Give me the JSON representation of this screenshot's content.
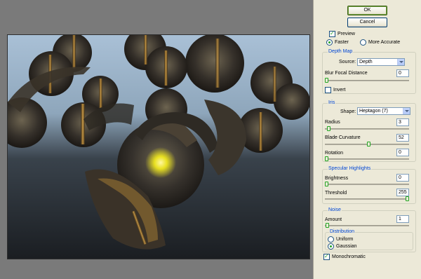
{
  "buttons": {
    "ok": "OK",
    "cancel": "Cancel"
  },
  "preview": {
    "label": "Preview",
    "checked": true
  },
  "quality": {
    "faster": "Faster",
    "more_accurate": "More Accurate",
    "selected": "faster"
  },
  "depth_map": {
    "title": "Depth Map",
    "source_label": "Source:",
    "source_value": "Depth",
    "blur_focal_label": "Blur Focal Distance",
    "blur_focal_value": "0",
    "blur_focal_level": 0,
    "invert_label": "Invert",
    "invert_checked": false
  },
  "iris": {
    "title": "Iris",
    "shape_label": "Shape:",
    "shape_value": "Heptagon (7)",
    "radius_label": "Radius",
    "radius_value": "3",
    "radius_level": 0.03,
    "blade_label": "Blade Curvature",
    "blade_value": "52",
    "blade_level": 0.52,
    "rotation_label": "Rotation",
    "rotation_value": "0",
    "rotation_level": 0
  },
  "specular": {
    "title": "Specular Highlights",
    "brightness_label": "Brightness",
    "brightness_value": "0",
    "brightness_level": 0,
    "threshold_label": "Threshold",
    "threshold_value": "255",
    "threshold_level": 1
  },
  "noise": {
    "title": "Noise",
    "amount_label": "Amount",
    "amount_value": "1",
    "amount_level": 0.01,
    "distribution_title": "Distribution",
    "uniform_label": "Uniform",
    "gaussian_label": "Gaussian",
    "distribution_selected": "gaussian",
    "monochromatic_label": "Monochromatic",
    "monochromatic_checked": true
  },
  "colors": {
    "legend": "#0046d5",
    "panel": "#ece9d8",
    "accent": "#21a121"
  }
}
